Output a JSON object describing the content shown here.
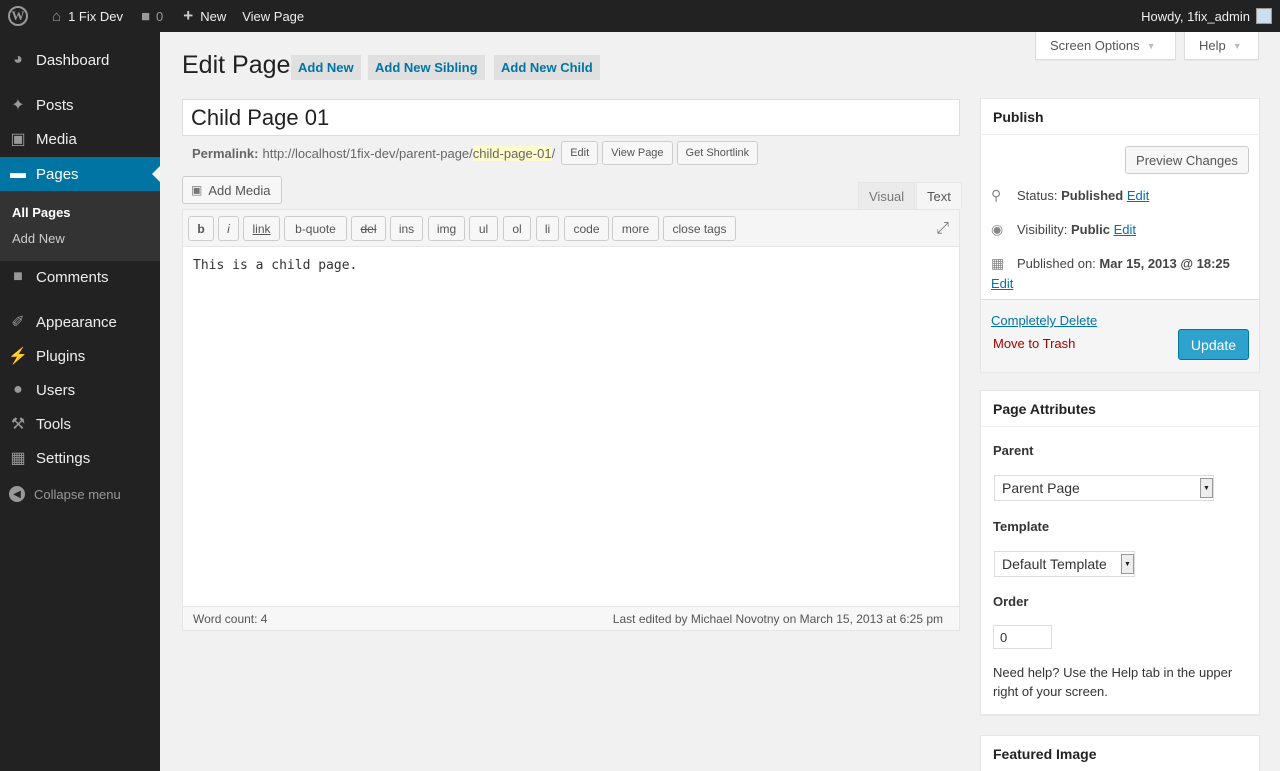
{
  "admin_bar": {
    "site_name": "1 Fix Dev",
    "comments_count": "0",
    "new_label": "New",
    "view_page": "View Page",
    "howdy": "Howdy, 1fix_admin"
  },
  "menu": {
    "items": [
      {
        "label": "Dashboard",
        "icon": "dashboard-icon"
      },
      {
        "label": "Posts",
        "icon": "pin-icon"
      },
      {
        "label": "Media",
        "icon": "media-icon"
      },
      {
        "label": "Pages",
        "icon": "pages-icon"
      },
      {
        "label": "Comments",
        "icon": "comment-icon"
      },
      {
        "label": "Appearance",
        "icon": "brush-icon"
      },
      {
        "label": "Plugins",
        "icon": "plugin-icon"
      },
      {
        "label": "Users",
        "icon": "user-icon"
      },
      {
        "label": "Tools",
        "icon": "wrench-icon"
      },
      {
        "label": "Settings",
        "icon": "settings-icon"
      }
    ],
    "submenu": [
      "All Pages",
      "Add New"
    ],
    "collapse": "Collapse menu"
  },
  "header": {
    "screen_options": "Screen Options",
    "help": "Help",
    "title": "Edit Page",
    "buttons": [
      "Add New",
      "Add New Sibling",
      "Add New Child"
    ]
  },
  "editor": {
    "title_value": "Child Page 01",
    "permalink_label": "Permalink:",
    "permalink_base": "http://localhost/1fix-dev/parent-page/",
    "permalink_slug": "child-page-01",
    "permalink_trail": "/",
    "permalink_buttons": [
      "Edit",
      "View Page",
      "Get Shortlink"
    ],
    "add_media": "Add Media",
    "tabs": [
      "Visual",
      "Text"
    ],
    "active_tab": "Text",
    "quicktags": [
      "b",
      "i",
      "link",
      "b-quote",
      "del",
      "ins",
      "img",
      "ul",
      "ol",
      "li",
      "code",
      "more",
      "close tags"
    ],
    "content": "This is a child page.",
    "word_count": "Word count: 4",
    "last_edited": "Last edited by Michael Novotny on March 15, 2013 at 6:25 pm"
  },
  "publish": {
    "title": "Publish",
    "preview": "Preview Changes",
    "status_label": "Status:",
    "status_value": "Published",
    "visibility_label": "Visibility:",
    "visibility_value": "Public",
    "published_on_label": "Published on:",
    "published_on_value": "Mar 15, 2013 @ 18:25",
    "edit": "Edit",
    "completely_delete": "Completely Delete",
    "move_to_trash": "Move to Trash",
    "update": "Update"
  },
  "page_attributes": {
    "title": "Page Attributes",
    "parent_label": "Parent",
    "parent_value": "Parent Page",
    "template_label": "Template",
    "template_value": "Default Template",
    "order_label": "Order",
    "order_value": "0",
    "help_text": "Need help? Use the Help tab in the upper right of your screen."
  },
  "featured_image": {
    "title": "Featured Image"
  },
  "colors": {
    "accent": "#0074a2",
    "primary_button": "#2ea2cc",
    "admin_bg": "#222222",
    "trash": "#a00000"
  }
}
